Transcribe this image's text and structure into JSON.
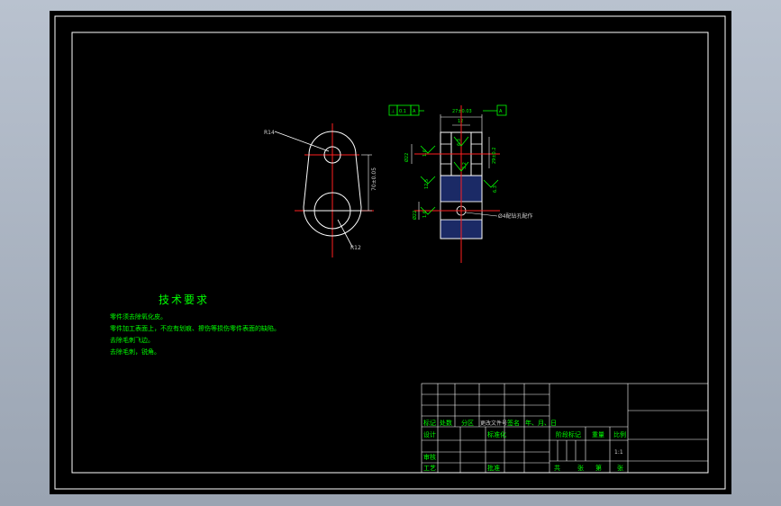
{
  "notes": {
    "title": "技术要求",
    "lines": [
      "零件须去除氧化皮。",
      "零件加工表面上，不应有划痕、擦伤等损伤零件表面的缺陷。",
      "去除毛刺飞边。",
      "去除毛刺，锐角。"
    ]
  },
  "front_view": {
    "label_top": "R14",
    "label_bottom": "R12",
    "label_right": "70±0.05"
  },
  "side_view": {
    "gdt_symbol": "⊥",
    "gdt_tolerance": "0.1",
    "gdt_datum": "A",
    "datum_box": "A",
    "top_dim": "27±0.03",
    "inner_dim": "12",
    "left_dim": "Ø22",
    "right_dim": "29±0.2",
    "lower_left_dim": "Ø22",
    "roughness_a": "6.3",
    "roughness_b": "3.2",
    "roughness_c": "1.6",
    "roughness_d": "12.5",
    "roughness_e": "1.6",
    "roughness_f": "6.3",
    "hole_callout": "Ø4配钻孔配作"
  },
  "title_block": {
    "row_labels": [
      "标记",
      "处数",
      "分区",
      "更改文件号",
      "签名",
      "年、月、日"
    ],
    "design": "设计",
    "standardize": "标准化",
    "review": "审核",
    "process": "工艺",
    "approve": "批准",
    "stage_mark": "阶段标记",
    "weight": "重量",
    "scale": "比例",
    "scale_value": "1:1",
    "sheets_total": "共",
    "sheet_word": "张",
    "sheet_no": "第",
    "sheet_word2": "张"
  }
}
